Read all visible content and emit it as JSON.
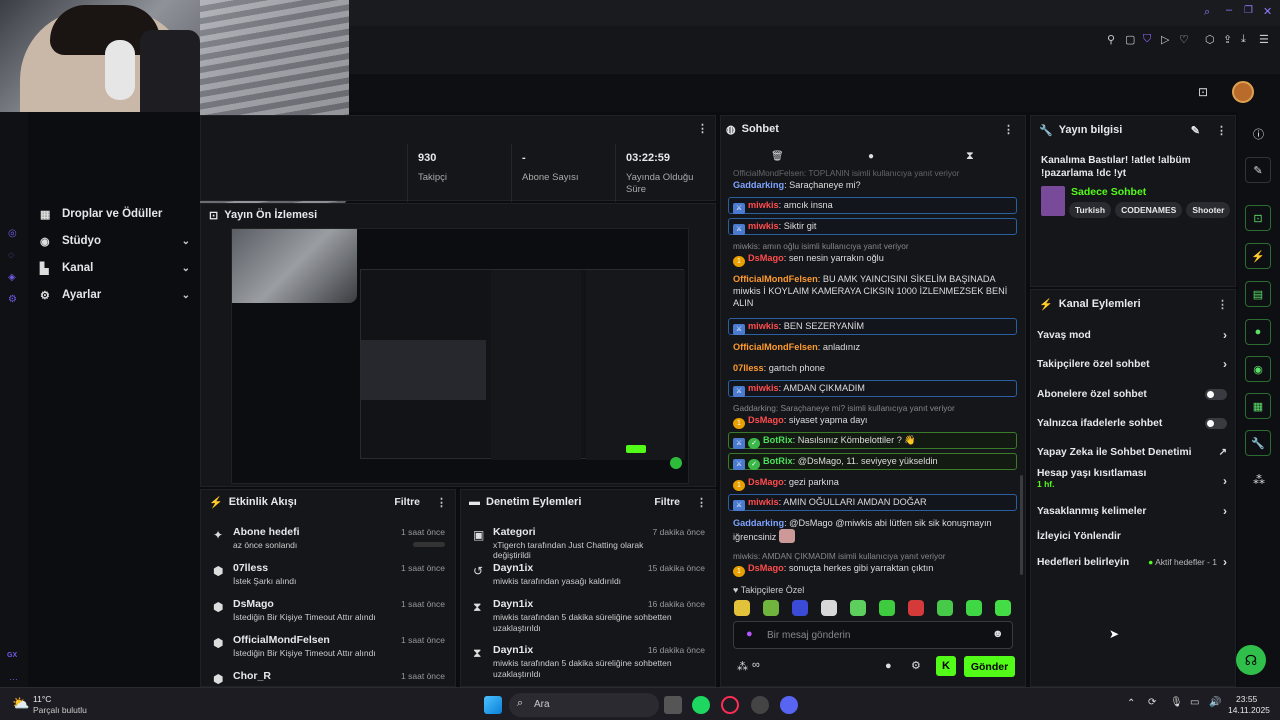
{
  "header": {
    "profile_label": "avatar"
  },
  "sidebar": {
    "items": [
      {
        "label": "Droplar ve Ödüller"
      },
      {
        "label": "Stüdyo"
      },
      {
        "label": "Kanal"
      },
      {
        "label": "Ayarlar"
      }
    ],
    "strip_label": "GX"
  },
  "stats": [
    {
      "value": "930",
      "label": "Takipçi"
    },
    {
      "value": "-",
      "label": "Abone Sayısı"
    },
    {
      "value": "03:22:59",
      "label": "Yayında Olduğu Süre"
    }
  ],
  "preview": {
    "title": "Yayın Ön İzlemesi"
  },
  "activity": {
    "title": "Etkinlik Akışı",
    "filter": "Filtre",
    "items": [
      {
        "title": "Abone hedefi",
        "sub": "az önce sonlandı",
        "time": "1 saat önce"
      },
      {
        "title": "07lless",
        "sub": "İstek Şarkı alındı",
        "time": "1 saat önce"
      },
      {
        "title": "DsMago",
        "sub": "İstediğin Bir Kişiye Timeout Attır alındı",
        "time": "1 saat önce"
      },
      {
        "title": "OfficialMondFelsen",
        "sub": "İstediğin Bir Kişiye Timeout Attır alındı",
        "time": "1 saat önce"
      },
      {
        "title": "Chor_R",
        "sub": "",
        "time": "1 saat önce"
      }
    ]
  },
  "moderation": {
    "title": "Denetim Eylemleri",
    "filter": "Filtre",
    "items": [
      {
        "title": "Kategori",
        "sub": "xTigerch tarafından Just Chatting olarak değiştirildi",
        "time": "7 dakika önce"
      },
      {
        "title": "Dayn1ix",
        "sub": "miwkis tarafından yasağı kaldırıldı",
        "time": "15 dakika önce"
      },
      {
        "title": "Dayn1ix",
        "sub": "miwkis tarafından 5 dakika süreliğine sohbetten uzaklaştırıldı",
        "time": "16 dakika önce"
      },
      {
        "title": "Dayn1ix",
        "sub": "miwkis tarafından 5 dakika süreliğine sohbetten uzaklaştırıldı",
        "time": "16 dakika önce"
      }
    ]
  },
  "chat": {
    "title": "Sohbet",
    "top_partial": "OfficialMondFelsen: TOPLANIN isimli kullanıcıya yanıt veriyor",
    "messages": [
      {
        "user": "Gaddarking",
        "text": ": Saraçhaneye mi?"
      },
      {
        "user": "miwkis",
        "text": ": amcık insna"
      },
      {
        "user": "miwkis",
        "text": ": Siktir git"
      },
      {
        "reply": "miwkis: amın oğlu isimli kullanıcıya yanıt veriyor",
        "user": "DsMago",
        "text": ": sen nesin yarrakın oğlu"
      },
      {
        "user": "OfficialMondFelsen",
        "text": ": BU AMK YAINCISINI SİKELİM BAŞINADA miwkis İ KOYLAIM KAMERAYA CIKSIN 1000 İZLENMEZSEK BENİ ALIN"
      },
      {
        "user": "miwkis",
        "text": ": BEN SEZERYANİM"
      },
      {
        "user": "OfficialMondFelsen",
        "text": ": anladınız"
      },
      {
        "user": "07lless",
        "text": ": gartıch phone"
      },
      {
        "user": "miwkis",
        "text": ": AMDAN ÇIKMADIM"
      },
      {
        "reply": "Gaddarking: Saraçhaneye mi? isimli kullanıcıya yanıt veriyor",
        "user": "DsMago",
        "text": ": siyaset yapma dayı"
      },
      {
        "user": "BotRix",
        "text": ": Nasılsınız Kömbelottiler ? 👋"
      },
      {
        "user": "BotRix",
        "text": ": @DsMago, 11. seviyeye yükseldin"
      },
      {
        "user": "DsMago",
        "text": ": gezi parkına"
      },
      {
        "user": "miwkis",
        "text": ": AMIN OĞULLARI AMDAN DOĞAR"
      },
      {
        "user": "Gaddarking",
        "text": ": @DsMago @miwkis abi lütfen sik sik konuşmayın iğrencsiniz"
      },
      {
        "reply": "miwkis: AMDAN ÇIKMADIM isimli kullanıcıya yanıt veriyor",
        "user": "DsMago",
        "text": ": sonuçta herkes gibi yarraktan çıktın"
      }
    ],
    "followers_only_label": "Takipçilere Özel",
    "input_placeholder": "Bir mesaj gönderin",
    "send_label": "Gönder"
  },
  "stream_info": {
    "title": "Yayın bilgisi",
    "stream_title": "Kanalıma Bastılar! !atlet !albüm !pazarlama !dc !yt",
    "category": "Sadece Sohbet",
    "tags": [
      "Turkish",
      "CODENAMES",
      "Shooter"
    ]
  },
  "channel_actions": {
    "title": "Kanal Eylemleri",
    "items": [
      {
        "label": "Yavaş mod",
        "type": "arrow"
      },
      {
        "label": "Takipçilere özel sohbet",
        "type": "arrow"
      },
      {
        "label": "Abonelere özel sohbet",
        "type": "toggle"
      },
      {
        "label": "Yalnızca ifadelerle sohbet",
        "type": "toggle"
      },
      {
        "label": "Yapay Zeka ile Sohbet Denetimi",
        "type": "ext"
      },
      {
        "label": "Hesap yaşı kısıtlaması",
        "type": "arrow",
        "sub": "1 hf."
      },
      {
        "label": "Yasaklanmış kelimeler",
        "type": "arrow"
      },
      {
        "label": "İzleyici Yönlendir",
        "type": "none"
      },
      {
        "label": "Hedefleri belirleyin",
        "type": "arrow",
        "extra": "Aktif hedefler - 1"
      }
    ]
  },
  "taskbar": {
    "weather_temp": "11°C",
    "weather_desc": "Parçalı bulutlu",
    "search_placeholder": "Ara",
    "time": "23:55",
    "date": "14.11.2025"
  },
  "colors": {
    "accent_green": "#53fc18",
    "mod_blue": "#2a5fa0"
  }
}
